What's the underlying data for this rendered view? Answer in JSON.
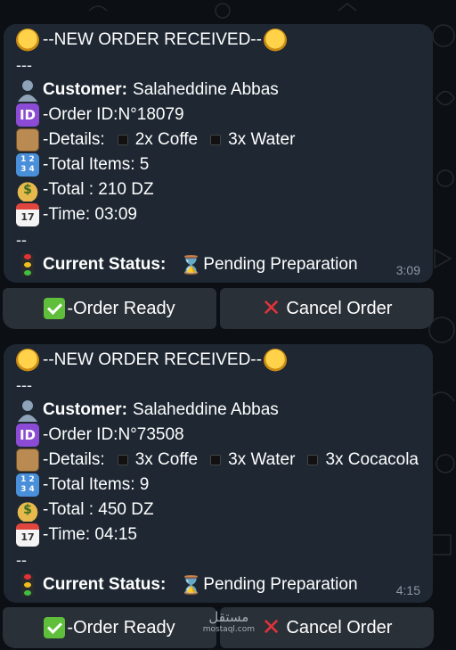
{
  "orders": [
    {
      "header": "--NEW ORDER RECEIVED--",
      "separator_top": "---",
      "customer_label": "Customer:",
      "customer_name": "Salaheddine Abbas",
      "order_id_text": "-Order ID:N°18079",
      "details_prefix": "-Details:",
      "details_items": [
        "2x Coffe",
        "3x Water"
      ],
      "total_items_text": "-Total Items: 5",
      "total_text": "-Total : 210 DZ",
      "time_text": "-Time: 03:09",
      "separator_bottom": "--",
      "status_label": "Current Status:",
      "status_value": "Pending Preparation",
      "timestamp": "3:09",
      "buttons": {
        "ready": "-Order Ready",
        "cancel": "Cancel Order"
      }
    },
    {
      "header": "--NEW ORDER RECEIVED--",
      "separator_top": "---",
      "customer_label": "Customer:",
      "customer_name": "Salaheddine Abbas",
      "order_id_text": "-Order ID:N°73508",
      "details_prefix": "-Details:",
      "details_items": [
        "3x Coffe",
        "3x Water",
        "3x Cocacola"
      ],
      "total_items_text": "-Total Items: 9",
      "total_text": "-Total : 450 DZ",
      "time_text": "-Time: 04:15",
      "separator_bottom": "--",
      "status_label": "Current Status:",
      "status_value": "Pending Preparation",
      "timestamp": "4:15",
      "buttons": {
        "ready": "-Order Ready",
        "cancel": "Cancel Order"
      }
    }
  ],
  "icons": {
    "header": "bell-icon",
    "customer": "person-silhouette-icon",
    "order_id": "id-badge-icon",
    "details": "package-icon",
    "total_items": "numbers-keycap-icon",
    "total": "money-bag-icon",
    "time": "calendar-icon",
    "status": "traffic-light-icon",
    "status_value": "hourglass-icon",
    "ready": "check-mark-icon",
    "cancel": "cross-mark-icon"
  },
  "watermark": {
    "main": "مستقل",
    "sub": "mostaql.com"
  },
  "colors": {
    "background": "#0c0f14",
    "bubble": "#1e2732",
    "button": "#2a3038",
    "timestamp": "#8d99a6",
    "check": "#5fbf3a",
    "cross": "#e2333a"
  }
}
